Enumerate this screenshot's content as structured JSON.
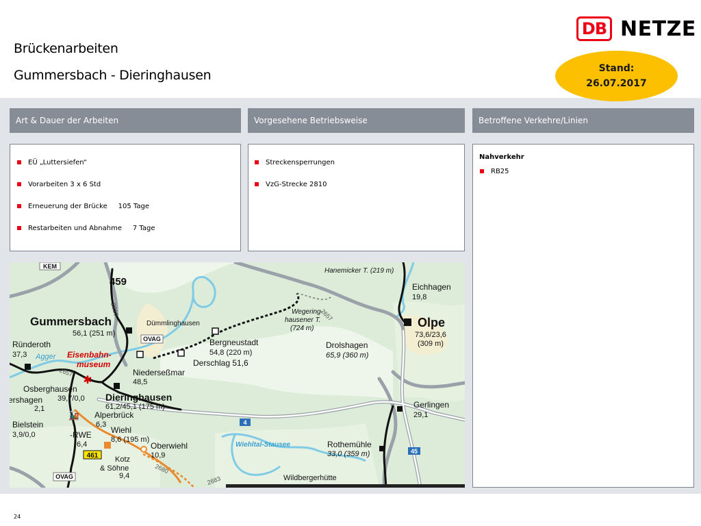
{
  "header": {
    "title_line1": "Brückenarbeiten",
    "title_line2": "Gummersbach - Dieringhausen"
  },
  "logo": {
    "db": "DB",
    "netze": "NETZE",
    "brand_color": "#ec0016"
  },
  "stand": {
    "label": "Stand:",
    "date": "26.07.2017",
    "color": "#fcc000"
  },
  "columns": [
    {
      "header": "Art & Dauer der Arbeiten",
      "items": [
        "EÜ „Luttersiefen“",
        "Vorarbeiten 3 x 6 Std",
        "Erneuerung der Brücke     105 Tage",
        "Restarbeiten und Abnahme     7 Tage"
      ]
    },
    {
      "header": "Vorgesehene Betriebsweise",
      "items": [
        "Streckensperrungen",
        "VzG-Strecke 2810"
      ]
    },
    {
      "header": "Betroffene Verkehre/Linien",
      "group_title": "Nahverkehr",
      "items": [
        "RB25"
      ]
    }
  ],
  "map": {
    "labels": {
      "kem": "KEM",
      "route459": "459",
      "route2810": "2810",
      "gummersbach": "Gummersbach",
      "gummersbach_km": "56,1 (251 m)",
      "duemmlinghausen": "Dümmlinghausen",
      "ovag1": "OVAG",
      "ruenderoth": "Ründeroth",
      "ruenderoth_km": "37,3",
      "agger": "Agger",
      "eisenbahnmuseum1": "Eisenbahn-",
      "eisenbahnmuseum2": "museum",
      "route2657a": "2657",
      "niederseszmar": "Niederseßmar",
      "niederseszmar_km": "48,5",
      "bergneustadt": "Bergneustadt",
      "bergneustadt_km": "54,8 (220 m)",
      "derschlag": "Derschlag 51,6",
      "osberghausen": "Osberghausen",
      "osberghausen_km": "39,7/0,0",
      "ershagen": "ershagen",
      "ershagen_km": "2,1",
      "dieringhausen": "Dieringhausen",
      "dieringhausen_km": "61,2/45,1 (175 m)",
      "alperbrueck": "Alperbrück",
      "alperbrueck_km": "6,3",
      "bielstein": "Bielstein",
      "bielstein_km": "3,9/0,0",
      "rwe": "-RWE",
      "rwe_km": "6,4",
      "wiehl": "Wiehl",
      "wiehl_km": "8,6 (195 m)",
      "route461": "461",
      "kotz1": "Kotz",
      "kotz2": "& Söhne",
      "kotz_km": "9,4",
      "oberwiehl": "Oberwiehl",
      "oberwiehl_km": "10,9",
      "route2680": "2680",
      "ovag2": "OVAG",
      "route2683": "2683",
      "hanemicker": "Hanemicker T. (219 m)",
      "eichhagen": "Eichhagen",
      "eichhagen_km": "19,8",
      "wegeringhausener1": "Wegering-",
      "wegeringhausener2": "hausener T.",
      "wegeringhausener3": "(724 m)",
      "route2657b": "2657",
      "olpe": "Olpe",
      "olpe_km1": "73,6/23,6",
      "olpe_km2": "(309 m)",
      "drolshagen": "Drolshagen",
      "drolshagen_km": "65,9 (360 m)",
      "gerlingen": "Gerlingen",
      "gerlingen_km": "29,1",
      "route4": "4",
      "wiehltal": "Wiehltal-Stausee",
      "rothemuehle": "Rothemühle",
      "rothemuehle_km": "33,0 (359 m)",
      "route45": "45",
      "wildbergerhuette": "Wildbergerhütte"
    }
  },
  "footer": {
    "page_number": "24"
  }
}
